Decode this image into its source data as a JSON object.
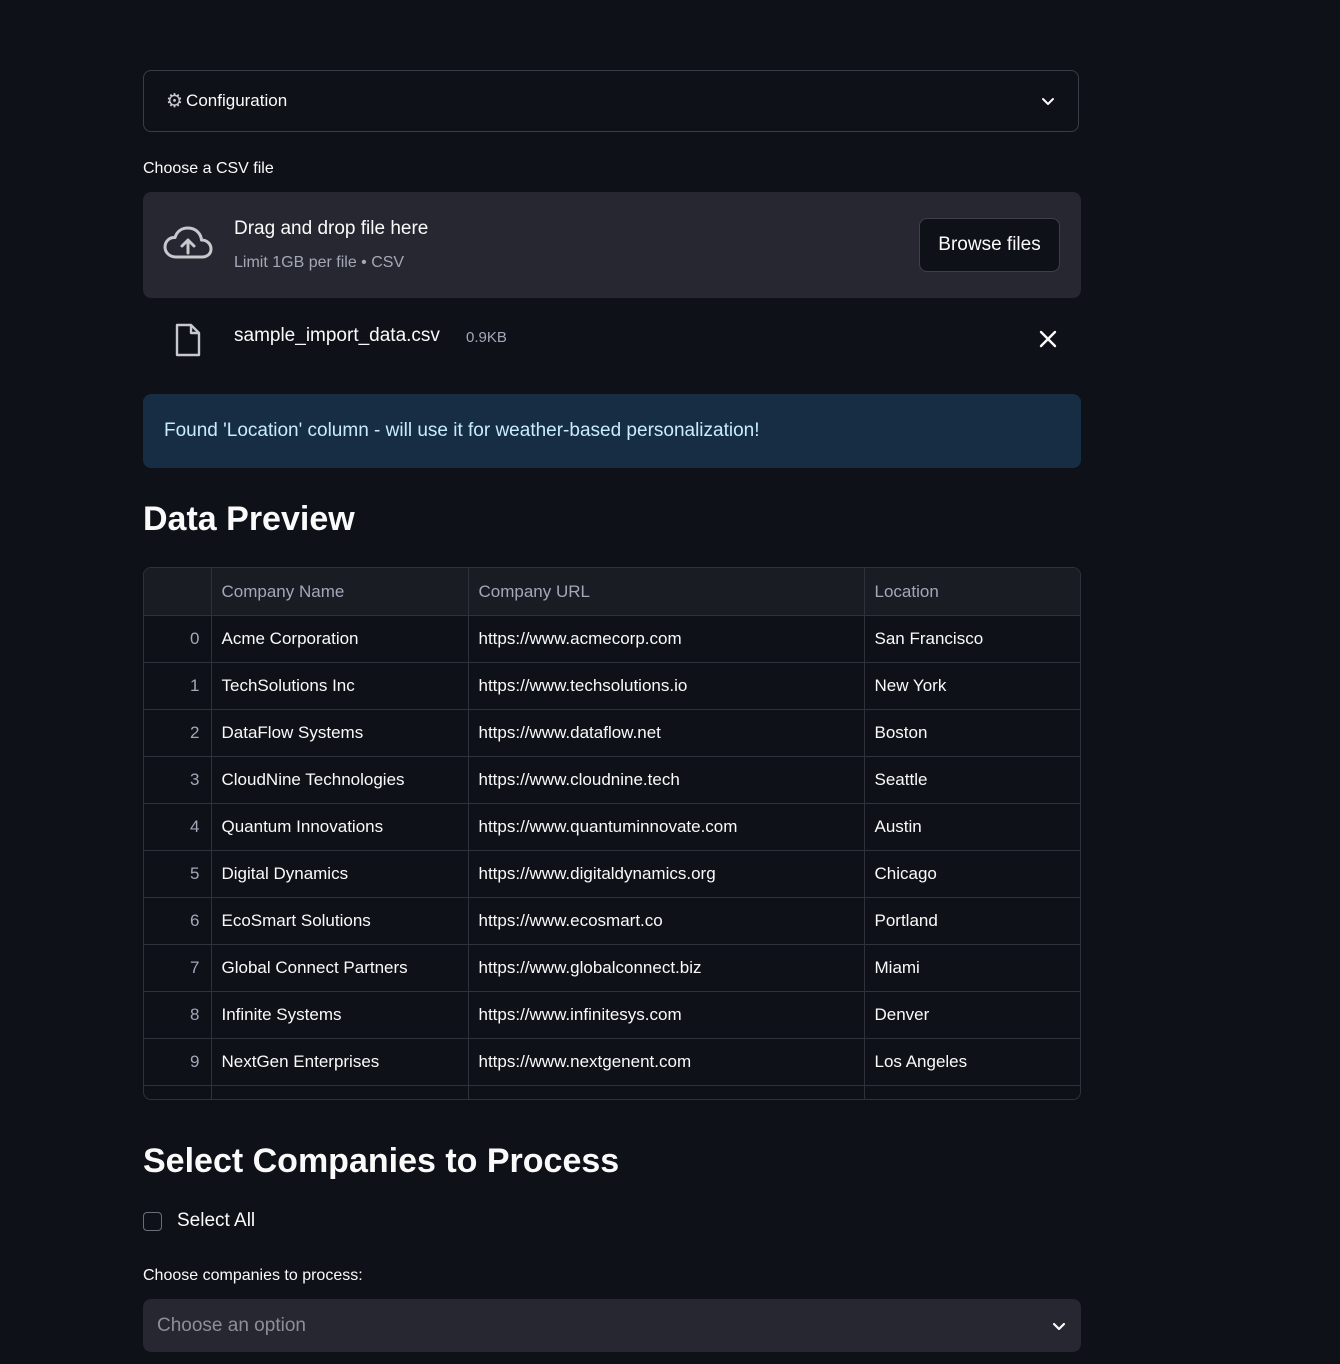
{
  "config": {
    "icon": "gear-icon",
    "label": "Configuration"
  },
  "uploader": {
    "label": "Choose a CSV file",
    "drop_title": "Drag and drop file here",
    "drop_subtitle": "Limit 1GB per file • CSV",
    "browse_label": "Browse files",
    "file": {
      "name": "sample_import_data.csv",
      "size": "0.9KB"
    }
  },
  "info_message": "Found 'Location' column - will use it for weather-based personalization!",
  "preview": {
    "title": "Data Preview",
    "columns": [
      "",
      "Company Name",
      "Company URL",
      "Location"
    ],
    "rows": [
      {
        "idx": "0",
        "name": "Acme Corporation",
        "url": "https://www.acmecorp.com",
        "location": "San Francisco"
      },
      {
        "idx": "1",
        "name": "TechSolutions Inc",
        "url": "https://www.techsolutions.io",
        "location": "New York"
      },
      {
        "idx": "2",
        "name": "DataFlow Systems",
        "url": "https://www.dataflow.net",
        "location": "Boston"
      },
      {
        "idx": "3",
        "name": "CloudNine Technologies",
        "url": "https://www.cloudnine.tech",
        "location": "Seattle"
      },
      {
        "idx": "4",
        "name": "Quantum Innovations",
        "url": "https://www.quantuminnovate.com",
        "location": "Austin"
      },
      {
        "idx": "5",
        "name": "Digital Dynamics",
        "url": "https://www.digitaldynamics.org",
        "location": "Chicago"
      },
      {
        "idx": "6",
        "name": "EcoSmart Solutions",
        "url": "https://www.ecosmart.co",
        "location": "Portland"
      },
      {
        "idx": "7",
        "name": "Global Connect Partners",
        "url": "https://www.globalconnect.biz",
        "location": "Miami"
      },
      {
        "idx": "8",
        "name": "Infinite Systems",
        "url": "https://www.infinitesys.com",
        "location": "Denver"
      },
      {
        "idx": "9",
        "name": "NextGen Enterprises",
        "url": "https://www.nextgenent.com",
        "location": "Los Angeles"
      }
    ]
  },
  "select_section": {
    "title": "Select Companies to Process",
    "select_all_label": "Select All",
    "select_all_checked": false,
    "multiselect_label": "Choose companies to process:",
    "multiselect_placeholder": "Choose an option"
  },
  "colors": {
    "background": "#0e1117",
    "surface": "#262730",
    "info_bg": "#172d43",
    "info_text": "#c7ebff"
  }
}
